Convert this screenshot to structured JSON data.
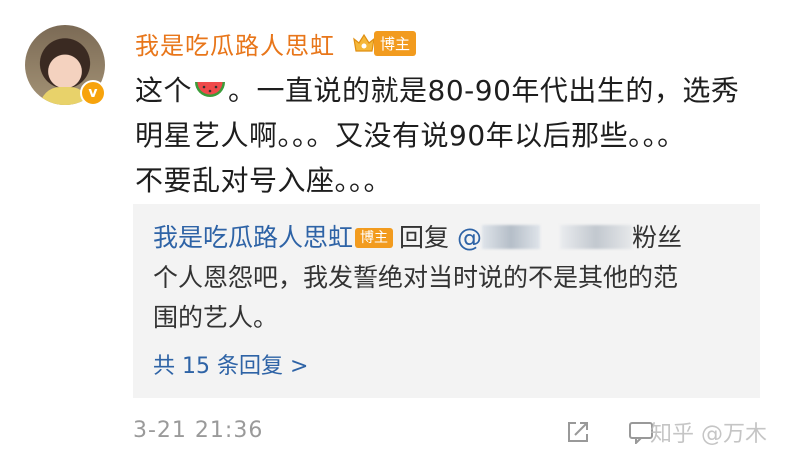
{
  "post": {
    "username": "我是吃瓜路人思虹",
    "role_badge": "博主",
    "verified_badge": "v",
    "content_line1_pre": "这个",
    "content_line1_post": "。一直说的就是80-90年代出生的，选秀",
    "content_line2": "明星艺人啊。。。又没有说90年以后那些。。。",
    "content_line3": "不要乱对号入座。。。",
    "emoji": "watermelon-icon"
  },
  "reply": {
    "username": "我是吃瓜路人思虹",
    "role_badge": "博主",
    "reply_word": "回复",
    "mention_prefix": "@",
    "text_after_mention": "粉丝",
    "line2": "个人恩怨吧，我发誓绝对当时说的不是其他的范",
    "line3": "围的艺人。",
    "more_replies": "共 15 条回复 >"
  },
  "footer": {
    "timestamp": "3-21 21:36",
    "watermark": "知乎 @万木"
  },
  "colors": {
    "username": "#e8761a",
    "badge": "#f29b1e",
    "link": "#2e63a6",
    "reply_bg": "#f3f3f3",
    "meta": "#9a9a9a"
  }
}
